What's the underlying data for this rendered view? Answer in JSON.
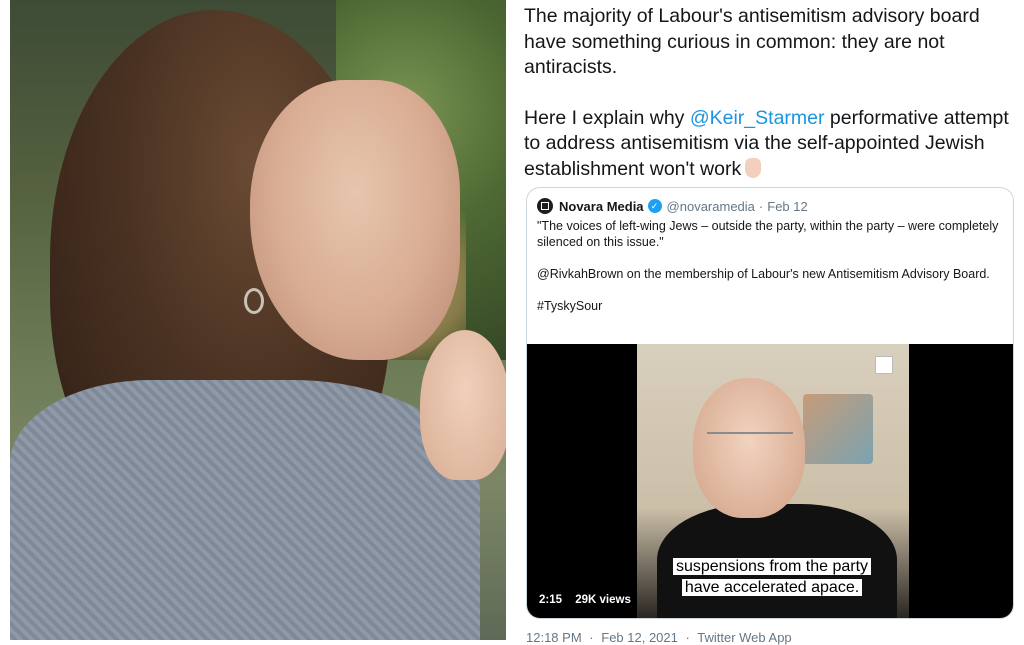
{
  "tweet": {
    "text_line_1": "The majority of Labour's antisemitism advisory board have something curious in common: they are not antiracists.",
    "text_line_2_prefix": "Here I explain why ",
    "mention": "@Keir_Starmer",
    "text_line_2_suffix": " performative attempt to address antisemitism via the self-appointed Jewish establishment won't work",
    "emoji": "backhand-index-pointing-down-icon"
  },
  "quoted": {
    "name": "Novara Media",
    "handle": "@novaramedia",
    "separator": "·",
    "date": "Feb 12",
    "body_1": "\"The voices of left-wing Jews – outside the party, within the party – were completely silenced on this issue.\"",
    "body_2": "@RivkahBrown on the membership of Labour's new Antisemitism Advisory Board.",
    "body_3": "#TyskySour"
  },
  "video": {
    "caption_line_1": "suspensions from the party",
    "caption_line_2": "have accelerated apace.",
    "duration": "2:15",
    "views": "29K views"
  },
  "footer": {
    "time": "12:18 PM",
    "sep": "·",
    "date": "Feb 12, 2021",
    "sep2": "·",
    "client": "Twitter Web App"
  }
}
